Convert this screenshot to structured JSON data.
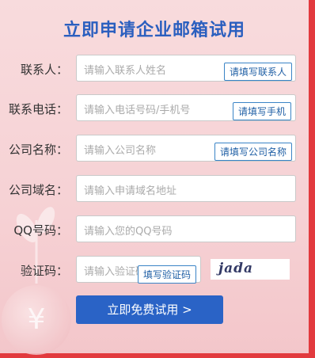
{
  "title": "立即申请企业邮箱试用",
  "fields": [
    {
      "label": "联系人：",
      "placeholder": "请输入联系人姓名",
      "tip": "请填写联系人"
    },
    {
      "label": "联系电话：",
      "placeholder": "请输入电话号码/手机号",
      "tip": "请填写手机"
    },
    {
      "label": "公司名称：",
      "placeholder": "请输入公司名称",
      "tip": "请填写公司名称"
    },
    {
      "label": "公司域名：",
      "placeholder": "请输入申请域名地址"
    },
    {
      "label": "QQ号码：",
      "placeholder": "请输入您的QQ号码"
    },
    {
      "label": "验证码：",
      "placeholder": "请输入验证码",
      "tip": "填写验证码"
    }
  ],
  "captcha_text": "jada",
  "submit_label": "立即免费试用 >",
  "decor": {
    "coin_symbol": "¥"
  },
  "colors": {
    "title": "#2b5fbf",
    "button": "#2a63c6",
    "frame": "#e23a3e"
  }
}
